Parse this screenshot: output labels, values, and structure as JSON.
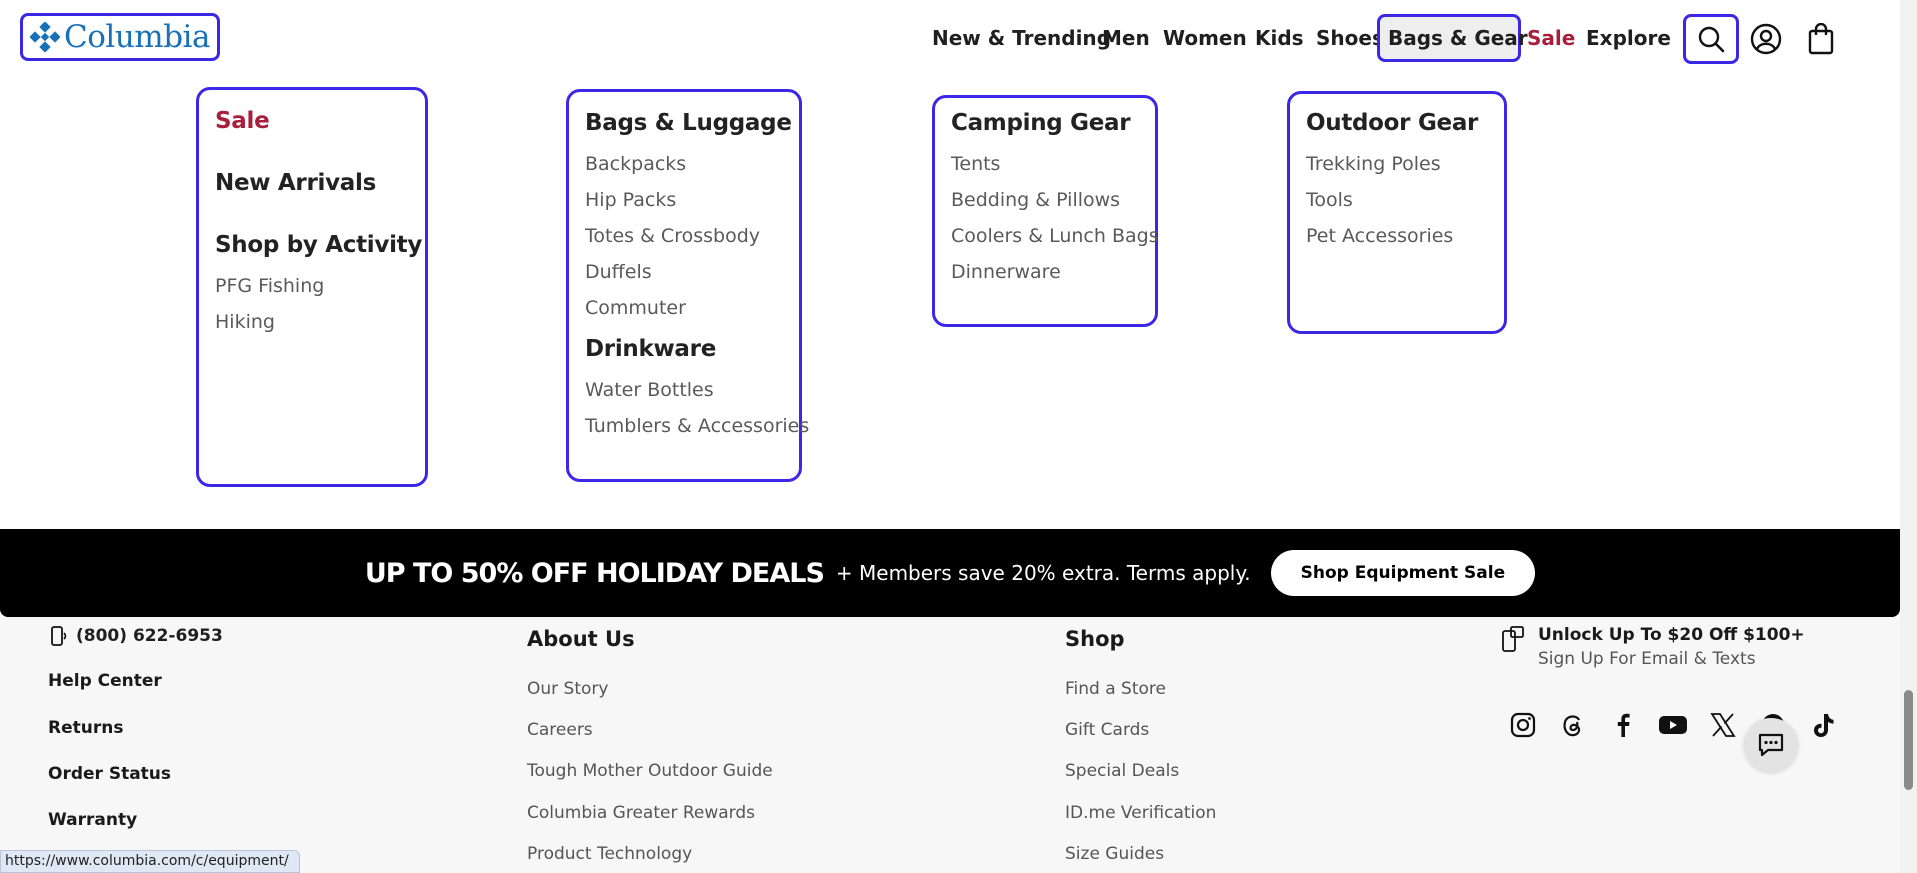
{
  "header": {
    "logo_text": "Columbia",
    "nav": [
      {
        "label": "New & Trending"
      },
      {
        "label": "Men"
      },
      {
        "label": "Women"
      },
      {
        "label": "Kids"
      },
      {
        "label": "Shoes"
      },
      {
        "label": "Bags & Gear",
        "active": true
      },
      {
        "label": "Sale"
      },
      {
        "label": "Explore"
      }
    ],
    "icons": [
      "search-icon",
      "account-icon",
      "cart-icon"
    ]
  },
  "mega_menu": {
    "col1": {
      "sale": "Sale",
      "new_arrivals": "New Arrivals",
      "shop_by_activity": "Shop by Activity",
      "links": [
        "PFG Fishing",
        "Hiking"
      ]
    },
    "col2": {
      "heading1": "Bags & Luggage",
      "links1": [
        "Backpacks",
        "Hip Packs",
        "Totes & Crossbody",
        "Duffels",
        "Commuter"
      ],
      "heading2": "Drinkware",
      "links2": [
        "Water Bottles",
        "Tumblers & Accessories"
      ]
    },
    "col3": {
      "heading": "Camping Gear",
      "links": [
        "Tents",
        "Bedding & Pillows",
        "Coolers & Lunch Bags",
        "Dinnerware"
      ]
    },
    "col4": {
      "heading": "Outdoor Gear",
      "links": [
        "Trekking Poles",
        "Tools",
        "Pet Accessories"
      ]
    }
  },
  "banner": {
    "main": "UP TO 50% OFF HOLIDAY DEALS",
    "sub": "+ Members save 20% extra. Terms apply.",
    "button": "Shop Equipment Sale"
  },
  "footer": {
    "phone": "(800) 622-6953",
    "help_links": [
      "Help Center",
      "Returns",
      "Order Status",
      "Warranty"
    ],
    "about": {
      "heading": "About Us",
      "links": [
        "Our Story",
        "Careers",
        "Tough Mother Outdoor Guide",
        "Columbia Greater Rewards",
        "Product Technology"
      ]
    },
    "shop": {
      "heading": "Shop",
      "links": [
        "Find a Store",
        "Gift Cards",
        "Special Deals",
        "ID.me Verification",
        "Size Guides"
      ]
    },
    "promo": {
      "title": "Unlock Up To $20 Off $100+",
      "subtitle": "Sign Up For Email & Texts"
    },
    "social": [
      "instagram-icon",
      "threads-icon",
      "facebook-icon",
      "youtube-icon",
      "x-icon",
      "pinterest-icon",
      "tiktok-icon"
    ]
  },
  "status_bar": {
    "url": "https://www.columbia.com/c/equipment/"
  },
  "colors": {
    "brand_blue": "#1871b6",
    "sale_red": "#a81f3d",
    "highlight": "#3b27e6"
  }
}
